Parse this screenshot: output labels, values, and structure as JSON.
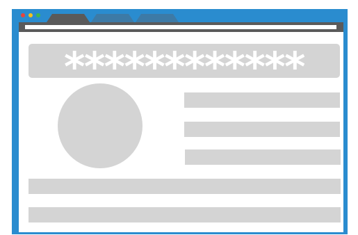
{
  "colors": {
    "frame": "#2a8ccf",
    "toolbar": "#5a5a5a",
    "placeholder": "#d4d4d4",
    "close_dot": "#e8453c",
    "minimize_dot": "#f4c21b",
    "maximize_dot": "#3fb552",
    "active_tab": "#5a5a5a",
    "inactive_tab": "#3d7aa6"
  },
  "window": {
    "tabs": [
      {
        "state": "active"
      },
      {
        "state": "inactive"
      },
      {
        "state": "inactive"
      }
    ]
  },
  "login": {
    "password_mask": "************"
  },
  "icons": {
    "avatar": "user-avatar-placeholder"
  }
}
